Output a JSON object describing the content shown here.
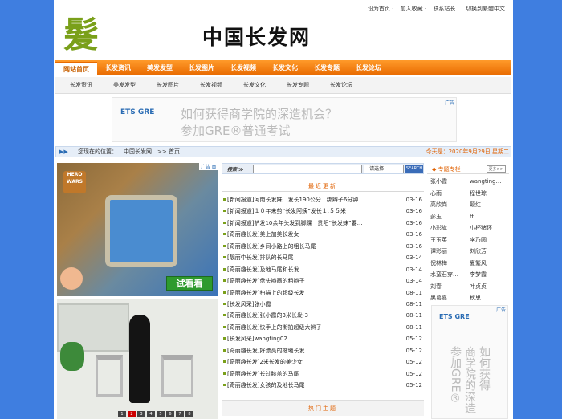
{
  "toplinks": [
    "设为首页",
    "加入收藏",
    "联系站长",
    "切换到繁體中文"
  ],
  "logo": {
    "mark": "髮",
    "text": "中国长发网"
  },
  "nav": [
    "网站首页",
    "长发资讯",
    "美发发型",
    "长发图片",
    "长发视频",
    "长发文化",
    "长发专题",
    "长发论坛"
  ],
  "subnav": [
    "长发资讯",
    "美发发型",
    "长发图片",
    "长发视频",
    "长发文化",
    "长发专题",
    "长发论坛"
  ],
  "banner_ad": {
    "brand": "ETS GRE",
    "line1": "如何获得商学院的深造机会？",
    "line2": "参加GRE®普通考试",
    "tag": "广告"
  },
  "breadcrumb": {
    "arrow": "▶▶",
    "label": "您现在的位置：",
    "site": "中国长发网",
    "sep": ">>",
    "current": "首页",
    "today": "今天是：2020年9月29日 星期二"
  },
  "left_ad": {
    "tag": "广告 ⊠",
    "game": "HERO WARS",
    "button": "试看看"
  },
  "left_slideshow": {
    "pages": [
      "1",
      "2",
      "3",
      "4",
      "5",
      "6",
      "7",
      "8"
    ],
    "active_page": "2"
  },
  "search": {
    "label": "搜索 ≫",
    "placeholder": "",
    "select": "- 请选择 -",
    "button": "SEARCH"
  },
  "latest": {
    "heading": "最近更新",
    "items": [
      {
        "title": "[新闻报道]河南长发妹　发长190公分　绑辫子6分钟…",
        "date": "03-16"
      },
      {
        "title": "[新闻报道]１０年未剪“长发阿姨”发长１.５５米",
        "date": "03-16"
      },
      {
        "title": "[新闻报道]护发10余年头发到脚踝　贵阳“长发妹”要…",
        "date": "03-16"
      },
      {
        "title": "[奇丽趣长发]美上加美长发女",
        "date": "03-16"
      },
      {
        "title": "[奇丽趣长发]乡间小路上的粗长马尾",
        "date": "03-16"
      },
      {
        "title": "[靓丽中长发]排队的长马尾",
        "date": "03-14"
      },
      {
        "title": "[奇丽趣长发]及地马尾和长发",
        "date": "03-14"
      },
      {
        "title": "[奇丽趣长发]盘头辫画的粗辫子",
        "date": "03-14"
      },
      {
        "title": "[奇丽趣长发]扫描上的超级长发",
        "date": "08-11"
      },
      {
        "title": "[长发风采]张小霞",
        "date": "08-11"
      },
      {
        "title": "[奇丽趣长发]张小霞的3米长发-3",
        "date": "08-11"
      },
      {
        "title": "[奇丽趣长发]快手上的街拍超级大辫子",
        "date": "08-11"
      },
      {
        "title": "[长发风采]wangting02",
        "date": "05-12"
      },
      {
        "title": "[奇丽趣长发]好漂亮的拖地长发",
        "date": "05-12"
      },
      {
        "title": "[奇丽趣长发]2米长发的美少女",
        "date": "05-12"
      },
      {
        "title": "[奇丽趣长发]长过膝盖的马尾",
        "date": "05-12"
      },
      {
        "title": "[奇丽趣长发]女孩的及地长马尾",
        "date": "05-12"
      }
    ]
  },
  "hot": {
    "heading": "热门主题"
  },
  "stars": {
    "heading": "◆ 专题专栏",
    "more": "更多>>",
    "names": [
      "张小霞",
      "wangting…",
      "心雨",
      "程世琼",
      "高欣岗",
      "颠红",
      "彭玉",
      "ff",
      "小彩旗",
      "小杯猪环",
      "王玉英",
      "李乃圆",
      "谭彩丽",
      "刘欣芳",
      "倪林梅",
      "夏繁风",
      "水蛮石穿…",
      "李梦霞",
      "刘春",
      "叶贞贞",
      "黑葛嘉",
      "秋思"
    ]
  },
  "right_ad": {
    "brand": "ETS GRE",
    "tag": "广告",
    "col1": "参加GRE®",
    "col2": "商学院的深造",
    "col3": "如何获得"
  }
}
